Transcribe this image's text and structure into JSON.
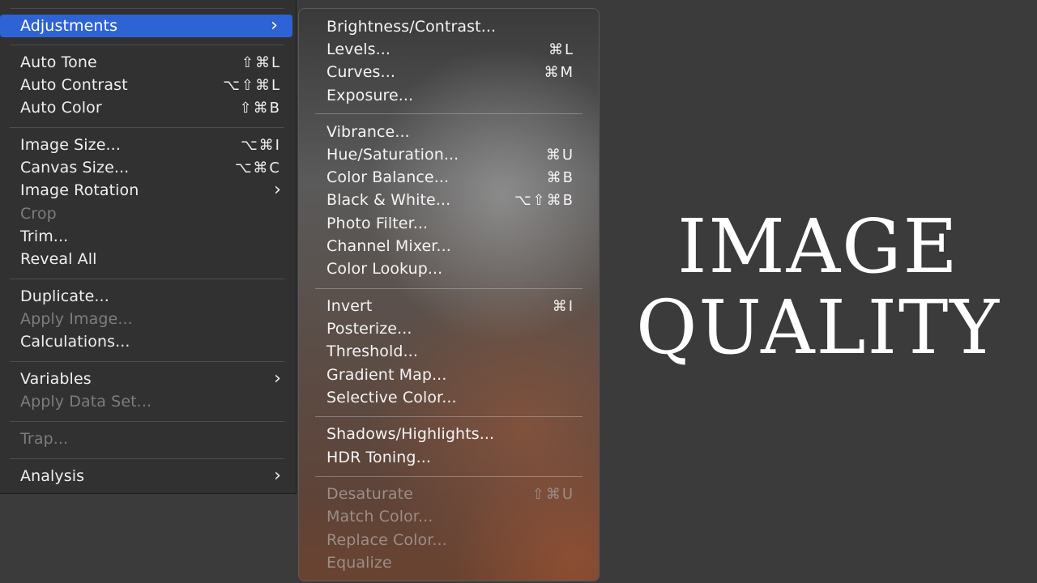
{
  "image_menu": {
    "items": [
      {
        "label": "Adjustments",
        "submenu": true,
        "highlighted": true
      },
      {
        "label": "Auto Tone",
        "shortcut": "⇧⌘L"
      },
      {
        "label": "Auto Contrast",
        "shortcut": "⌥⇧⌘L"
      },
      {
        "label": "Auto Color",
        "shortcut": "⇧⌘B"
      },
      {
        "label": "Image Size...",
        "shortcut": "⌥⌘I"
      },
      {
        "label": "Canvas Size...",
        "shortcut": "⌥⌘C"
      },
      {
        "label": "Image Rotation",
        "submenu": true
      },
      {
        "label": "Crop",
        "disabled": true
      },
      {
        "label": "Trim..."
      },
      {
        "label": "Reveal All"
      },
      {
        "label": "Duplicate..."
      },
      {
        "label": "Apply Image...",
        "disabled": true
      },
      {
        "label": "Calculations..."
      },
      {
        "label": "Variables",
        "submenu": true
      },
      {
        "label": "Apply Data Set...",
        "disabled": true
      },
      {
        "label": "Trap...",
        "disabled": true
      },
      {
        "label": "Analysis",
        "submenu": true
      }
    ],
    "chevron": "›"
  },
  "adjustments_menu": {
    "items": [
      {
        "label": "Brightness/Contrast..."
      },
      {
        "label": "Levels...",
        "shortcut": "⌘L"
      },
      {
        "label": "Curves...",
        "shortcut": "⌘M"
      },
      {
        "label": "Exposure..."
      },
      {
        "label": "Vibrance..."
      },
      {
        "label": "Hue/Saturation...",
        "shortcut": "⌘U"
      },
      {
        "label": "Color Balance...",
        "shortcut": "⌘B"
      },
      {
        "label": "Black & White...",
        "shortcut": "⌥⇧⌘B"
      },
      {
        "label": "Photo Filter..."
      },
      {
        "label": "Channel Mixer..."
      },
      {
        "label": "Color Lookup..."
      },
      {
        "label": "Invert",
        "shortcut": "⌘I"
      },
      {
        "label": "Posterize..."
      },
      {
        "label": "Threshold..."
      },
      {
        "label": "Gradient Map..."
      },
      {
        "label": "Selective Color..."
      },
      {
        "label": "Shadows/Highlights..."
      },
      {
        "label": "HDR Toning..."
      },
      {
        "label": "Desaturate",
        "shortcut": "⇧⌘U",
        "disabled": true
      },
      {
        "label": "Match Color...",
        "disabled": true
      },
      {
        "label": "Replace Color...",
        "disabled": true
      },
      {
        "label": "Equalize",
        "disabled": true
      }
    ]
  },
  "title": {
    "line1": "IMAGE",
    "line2": "QUALITY"
  },
  "colors": {
    "highlight": "#2e63d6",
    "background": "#3b3b3b",
    "menu_bg": "#313131"
  }
}
